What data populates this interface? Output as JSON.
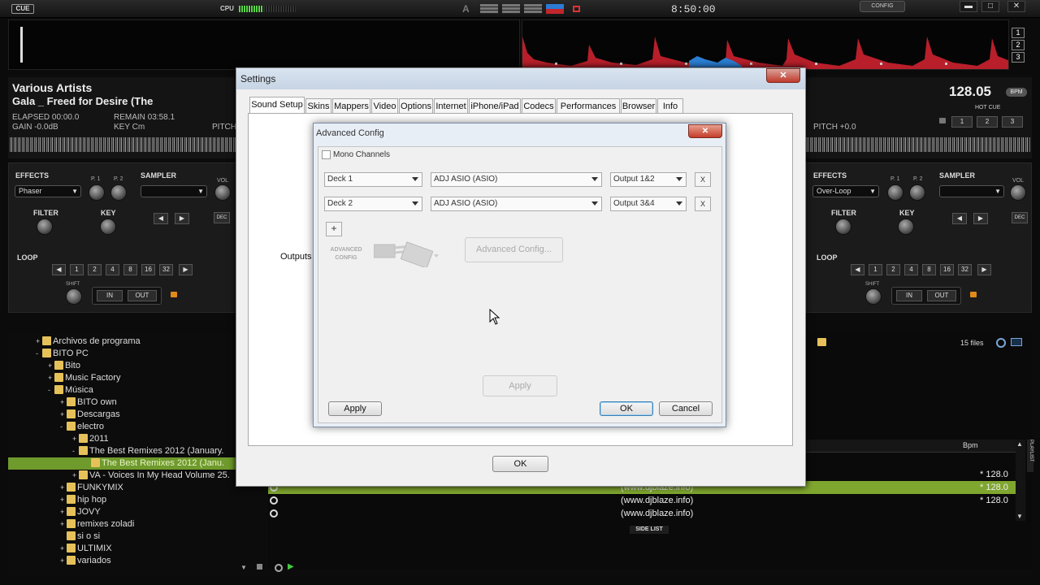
{
  "topbar": {
    "logo": "CUE",
    "cpu_label": "CPU",
    "layout_label": "A",
    "clock": "8:50:00",
    "config": "CONFIG",
    "min": "▬",
    "max": "□",
    "close": "✕"
  },
  "deck_numbers": [
    "1",
    "2",
    "3"
  ],
  "left_deck": {
    "artist": "Various Artists",
    "title": "Gala _ Freed for Desire (The",
    "elapsed": "ELAPSED 00:00.0",
    "remain": "REMAIN 03:58.1",
    "gain": "GAIN -0.0dB",
    "key": "KEY Cm",
    "pitch": "PITCH",
    "effects_label": "EFFECTS",
    "effect": "Phaser",
    "p1": "P. 1",
    "p2": "P. 2",
    "sampler_label": "SAMPLER",
    "vol": "VOL",
    "filter": "FILTER",
    "key_label": "KEY",
    "dec": "DEC",
    "loop_label": "LOOP",
    "loop_sizes": [
      "1",
      "2",
      "4",
      "8",
      "16",
      "32"
    ],
    "shift": "SHIFT",
    "in": "IN",
    "out": "OUT"
  },
  "right_deck": {
    "bpm": "128.05",
    "bpm_unit": "BPM",
    "hot_cue": "HOT CUE",
    "hot_cues": [
      "1",
      "2",
      "3"
    ],
    "pitch": "PITCH +0.0",
    "effects_label": "EFFECTS",
    "effect": "Over-Loop",
    "p1": "P. 1",
    "p2": "P. 2",
    "sampler_label": "SAMPLER",
    "vol": "VOL",
    "filter": "FILTER",
    "key_label": "KEY",
    "dec": "DEC",
    "loop_label": "LOOP",
    "loop_sizes": [
      "1",
      "2",
      "4",
      "8",
      "16",
      "32"
    ],
    "shift": "SHIFT",
    "in": "IN",
    "out": "OUT"
  },
  "browser": {
    "tree": [
      {
        "label": "Archivos de programa",
        "level": 2,
        "toggle": "+"
      },
      {
        "label": "BITO PC",
        "level": 2,
        "toggle": "-"
      },
      {
        "label": "Bito",
        "level": 3,
        "toggle": "+"
      },
      {
        "label": "Music Factory",
        "level": 3,
        "toggle": "+"
      },
      {
        "label": "Música",
        "level": 3,
        "toggle": "-"
      },
      {
        "label": "BITO own",
        "level": 4,
        "toggle": "+"
      },
      {
        "label": "Descargas",
        "level": 4,
        "toggle": "+"
      },
      {
        "label": "electro",
        "level": 4,
        "toggle": "-"
      },
      {
        "label": "2011",
        "level": 5,
        "toggle": "+"
      },
      {
        "label": "The Best Remixes 2012 (January.",
        "level": 5,
        "toggle": "-"
      },
      {
        "label": "The Best Remixes 2012 (Janu.",
        "level": 6,
        "toggle": ""
      },
      {
        "label": "VA - Voices In My Head Volume 25.",
        "level": 5,
        "toggle": "+"
      },
      {
        "label": "FUNKYMIX",
        "level": 4,
        "toggle": "+"
      },
      {
        "label": "hip hop",
        "level": 4,
        "toggle": "+"
      },
      {
        "label": "JOVY",
        "level": 4,
        "toggle": "+"
      },
      {
        "label": "remixes zoladi",
        "level": 4,
        "toggle": "+"
      },
      {
        "label": "si o si",
        "level": 4,
        "toggle": ""
      },
      {
        "label": "ULTIMIX",
        "level": 4,
        "toggle": "+"
      },
      {
        "label": "variados",
        "level": 4,
        "toggle": "+"
      }
    ],
    "files_count": "15 files",
    "bpm_header": "Bpm",
    "rows": [
      {
        "comment": "",
        "bpm": "* 128.0",
        "selected": false
      },
      {
        "comment": "(www.djblaze.info)",
        "bpm": "* 128.0",
        "selected": true
      },
      {
        "comment": "(www.djblaze.info)",
        "bpm": "* 128.0",
        "selected": false
      },
      {
        "comment": "(www.djblaze.info)",
        "bpm": "",
        "selected": false
      }
    ],
    "side_list": "SIDE LIST",
    "playlist": "PLAYLIST"
  },
  "settings": {
    "title": "Settings",
    "close": "✕",
    "tabs": [
      "Sound Setup",
      "Skins",
      "Mappers",
      "Video",
      "Options",
      "Internet",
      "iPhone/iPad",
      "Codecs",
      "Performances",
      "Browser",
      "Info"
    ],
    "outputs_label": "Outputs :",
    "ok": "OK"
  },
  "advanced": {
    "title": "Advanced Config",
    "close": "✕",
    "mono_channels": "Mono Channels",
    "rows": [
      {
        "deck": "Deck 1",
        "driver": "ADJ ASIO (ASIO)",
        "output": "Output 1&2",
        "remove": "X"
      },
      {
        "deck": "Deck 2",
        "driver": "ADJ ASIO (ASIO)",
        "output": "Output 3&4",
        "remove": "X"
      }
    ],
    "add": "+",
    "adv_config_logo": "ADVANCED CONFIG",
    "adv_config_btn": "Advanced Config...",
    "apply_inner": "Apply",
    "apply": "Apply",
    "ok": "OK",
    "cancel": "Cancel"
  }
}
